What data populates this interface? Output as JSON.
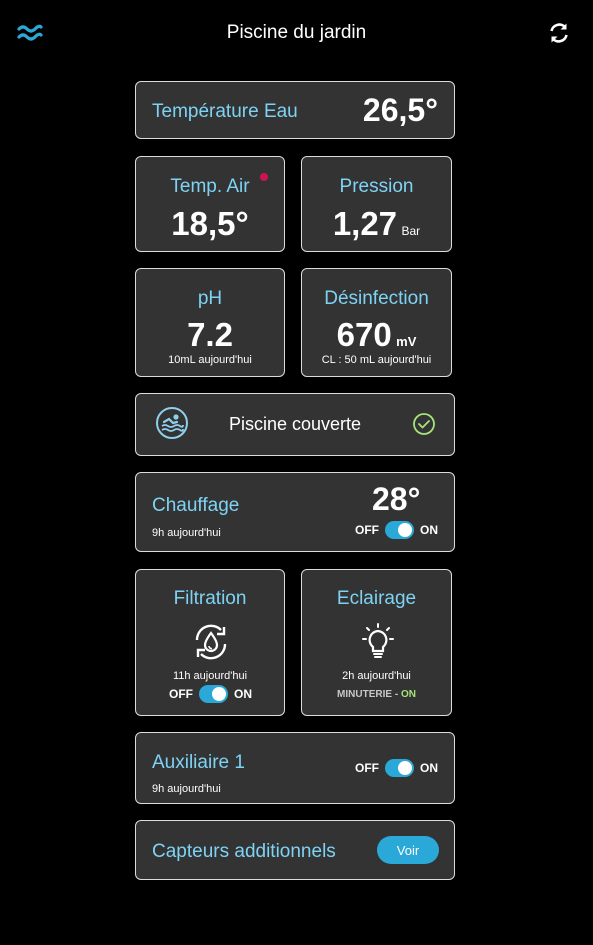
{
  "header": {
    "title": "Piscine du jardin"
  },
  "water_temp": {
    "label": "Température Eau",
    "value": "26,5°"
  },
  "air_temp": {
    "label": "Temp. Air",
    "value": "18,5°"
  },
  "pressure": {
    "label": "Pression",
    "value": "1,27",
    "unit": "Bar"
  },
  "ph": {
    "label": "pH",
    "value": "7.2",
    "note": "10mL aujourd'hui"
  },
  "disinfection": {
    "label": "Désinfection",
    "value": "670",
    "unit": "mV",
    "note": "CL : 50 mL aujourd'hui"
  },
  "cover": {
    "label": "Piscine couverte"
  },
  "heating": {
    "label": "Chauffage",
    "value": "28°",
    "note": "9h aujourd'hui",
    "off": "OFF",
    "on": "ON"
  },
  "filtration": {
    "label": "Filtration",
    "note": "11h aujourd'hui",
    "off": "OFF",
    "on": "ON"
  },
  "lighting": {
    "label": "Eclairage",
    "note": "2h aujourd'hui",
    "mode": "MINUTERIE",
    "sep": " - ",
    "state": "ON"
  },
  "auxiliary": {
    "label": "Auxiliaire 1",
    "note": "9h aujourd'hui",
    "off": "OFF",
    "on": "ON"
  },
  "sensors": {
    "label": "Capteurs additionnels",
    "button": "Voir"
  },
  "colors": {
    "accent": "#7ed3f4",
    "toggle": "#2aa8d8",
    "on_green": "#a6e37a",
    "alert_dot": "#d3134f",
    "card_bg": "#333333"
  }
}
